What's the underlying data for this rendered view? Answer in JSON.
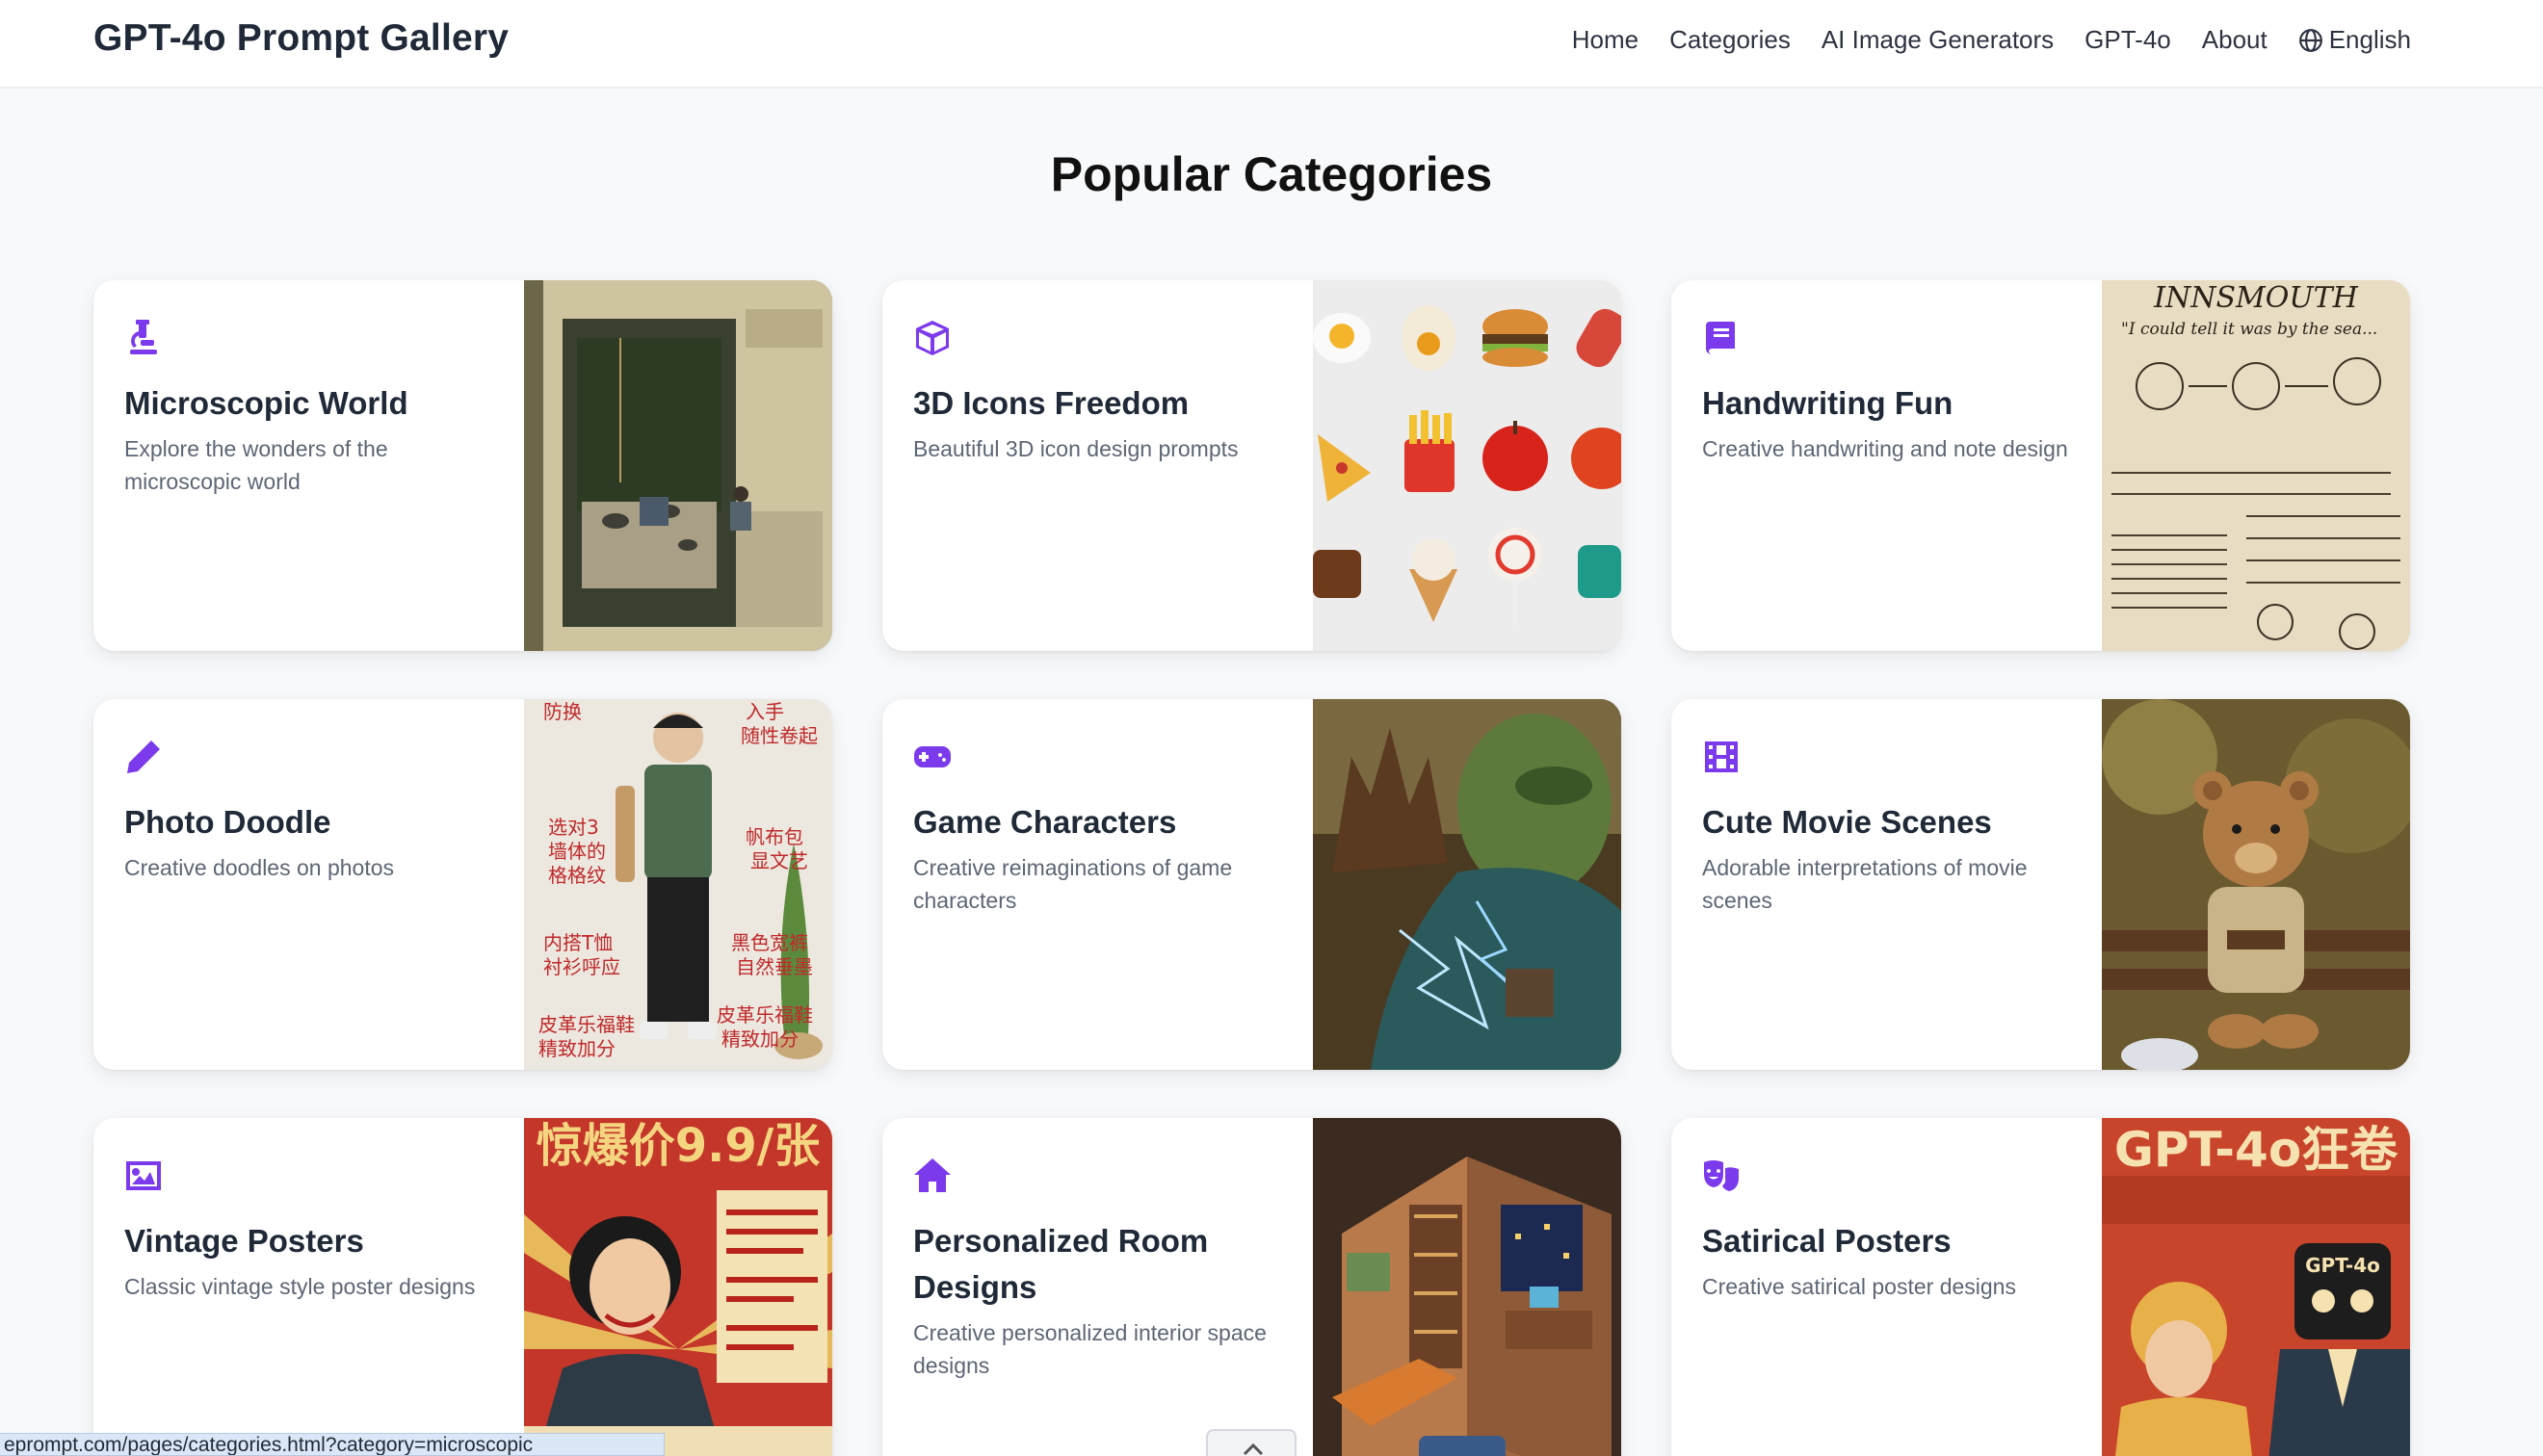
{
  "header": {
    "brand": "GPT-4o Prompt Gallery",
    "nav": [
      "Home",
      "Categories",
      "AI Image Generators",
      "GPT-4o",
      "About"
    ],
    "language": "English"
  },
  "section_title": "Popular Categories",
  "categories": [
    {
      "icon": "microscope-icon",
      "name": "Microscopic World",
      "desc": "Explore the wonders of the microscopic world"
    },
    {
      "icon": "cube-icon",
      "name": "3D Icons Freedom",
      "desc": "Beautiful 3D icon design prompts"
    },
    {
      "icon": "book-icon",
      "name": "Handwriting Fun",
      "desc": "Creative handwriting and note design"
    },
    {
      "icon": "pencil-icon",
      "name": "Photo Doodle",
      "desc": "Creative doodles on photos"
    },
    {
      "icon": "gamepad-icon",
      "name": "Game Characters",
      "desc": "Creative reimaginations of game characters"
    },
    {
      "icon": "film-icon",
      "name": "Cute Movie Scenes",
      "desc": "Adorable interpretations of movie scenes"
    },
    {
      "icon": "image-icon",
      "name": "Vintage Posters",
      "desc": "Classic vintage style poster designs"
    },
    {
      "icon": "house-icon",
      "name": "Personalized Room Designs",
      "desc": "Creative personalized interior space designs"
    },
    {
      "icon": "masks-icon",
      "name": "Satirical Posters",
      "desc": "Creative satirical poster designs"
    }
  ],
  "thumb_text": {
    "handwriting_heading": "INNSMOUTH",
    "handwriting_line": "\"I could tell it was by the sea...",
    "vintage_poster": "惊爆价9.9/张",
    "satire_poster": "GPT-4o狂卷",
    "satire_robot": "GPT-4o"
  },
  "status_url": "eprompt.com/pages/categories.html?category=microscopic",
  "colors": {
    "accent": "#7c3aed",
    "background": "#f8f9fb"
  }
}
